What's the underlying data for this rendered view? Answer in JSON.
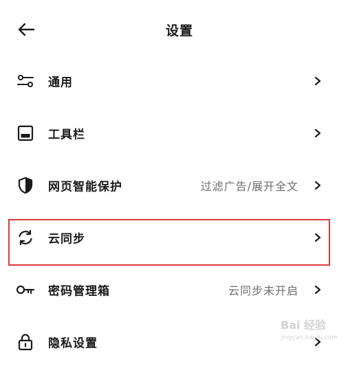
{
  "header": {
    "back_icon": "arrow-left-icon",
    "title": "设置"
  },
  "settings": {
    "general": {
      "label": "通用",
      "icon": "sliders-icon"
    },
    "toolbar": {
      "label": "工具栏",
      "icon": "toolbar-icon"
    },
    "web_protection": {
      "label": "网页智能保护",
      "value": "过滤广告/展开全文",
      "icon": "shield-icon"
    },
    "cloud_sync": {
      "label": "云同步",
      "icon": "sync-icon"
    },
    "password_manager": {
      "label": "密码管理箱",
      "value": "云同步未开启",
      "icon": "key-icon"
    },
    "privacy": {
      "label": "隐私设置",
      "icon": "lock-icon"
    }
  },
  "annotation": {
    "highlight_color": "#d9383c"
  },
  "watermark": {
    "text": "Bai 经验",
    "sub": "jingyan.baidu.com"
  }
}
